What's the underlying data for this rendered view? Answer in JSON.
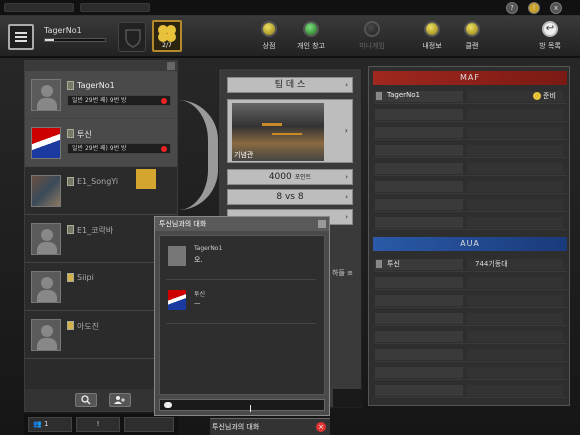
{
  "window": {
    "controls": [
      "?",
      "!",
      "x"
    ]
  },
  "player": {
    "name": "TagerNo1",
    "exp_fraction": 0.15,
    "clover_count": "2/7"
  },
  "header_buttons": [
    {
      "label": "상점",
      "state": "yellow"
    },
    {
      "label": "개인 창고",
      "state": "green"
    },
    {
      "label": "미니게임",
      "state": "disabled"
    },
    {
      "label": "내정보",
      "state": "yellow"
    },
    {
      "label": "클랜",
      "state": "yellow"
    },
    {
      "label": "방 목록",
      "state": "exit"
    }
  ],
  "room_players": [
    {
      "name": "TagerNo1",
      "stat": "일반  29번 째)  9번 방",
      "avatar": "silhouette",
      "selected": true
    },
    {
      "name": "투신",
      "stat": "일반  29번 째)  9번 방",
      "avatar": "flag",
      "selected": true
    },
    {
      "name": "E1_SongYi",
      "stat": "",
      "avatar": "photo",
      "selected": false
    },
    {
      "name": "E1_코락바",
      "stat": "",
      "avatar": "silhouette",
      "selected": false
    },
    {
      "name": "Siipi",
      "stat": "",
      "avatar": "silhouette",
      "selected": false
    },
    {
      "name": "아도진",
      "stat": "",
      "avatar": "silhouette",
      "selected": false
    }
  ],
  "left_footer": {
    "search_icon": "search-icon",
    "add_user_icon": "add-user-icon"
  },
  "bottom_bar": {
    "count": "1",
    "alert": "!"
  },
  "game_settings": {
    "mode": "팀 데 스",
    "map_name": "기념관",
    "points_value": "4000",
    "points_unit": "포인트",
    "team_size": "8 vs 8"
  },
  "teams": {
    "maf": {
      "name": "MAF",
      "members": [
        {
          "name": "TagerNo1",
          "status": "준비"
        }
      ]
    },
    "aua": {
      "name": "AUA",
      "members": [
        {
          "name": "투신",
          "info": "744기동대"
        }
      ]
    }
  },
  "side_text": "하들 ≡",
  "chat": {
    "title": "투신님과의 대화",
    "messages": [
      {
        "name": "TagerNo1",
        "text": "오.",
        "avatar": "silhouette"
      },
      {
        "name": "투신",
        "text": "ㅡ",
        "avatar": "flag"
      }
    ],
    "tab_label": "투신님과의 대화"
  }
}
